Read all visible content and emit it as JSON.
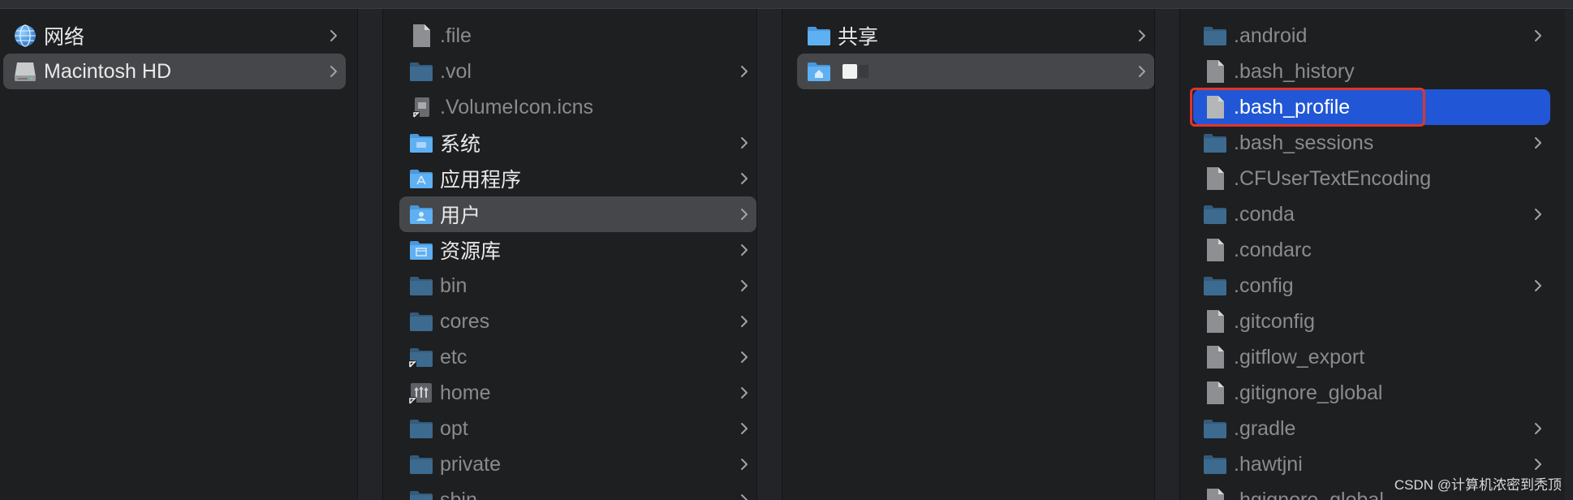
{
  "columns": [
    {
      "items": [
        {
          "label": "网络",
          "icon": "network-globe-icon",
          "chevron": true,
          "state": "normal",
          "tone": "bright"
        },
        {
          "label": "Macintosh HD",
          "icon": "hard-drive-icon",
          "chevron": true,
          "state": "selected-inactive",
          "tone": "bright"
        }
      ]
    },
    {
      "items": [
        {
          "label": ".file",
          "icon": "document-icon",
          "chevron": false,
          "state": "normal",
          "tone": "dim"
        },
        {
          "label": ".vol",
          "icon": "folder-icon",
          "chevron": true,
          "state": "normal",
          "tone": "dim"
        },
        {
          "label": ".VolumeIcon.icns",
          "icon": "alias-icns-file-icon",
          "chevron": false,
          "state": "normal",
          "tone": "dim"
        },
        {
          "label": "系统",
          "icon": "system-folder-icon",
          "chevron": true,
          "state": "normal",
          "tone": "bright"
        },
        {
          "label": "应用程序",
          "icon": "applications-folder-icon",
          "chevron": true,
          "state": "normal",
          "tone": "bright"
        },
        {
          "label": "用户",
          "icon": "users-folder-icon",
          "chevron": true,
          "state": "selected-inactive",
          "tone": "bright"
        },
        {
          "label": "资源库",
          "icon": "library-folder-icon",
          "chevron": true,
          "state": "normal",
          "tone": "bright"
        },
        {
          "label": "bin",
          "icon": "folder-icon",
          "chevron": true,
          "state": "normal",
          "tone": "dim"
        },
        {
          "label": "cores",
          "icon": "folder-icon",
          "chevron": true,
          "state": "normal",
          "tone": "dim"
        },
        {
          "label": "etc",
          "icon": "alias-folder-icon",
          "chevron": true,
          "state": "normal",
          "tone": "dim"
        },
        {
          "label": "home",
          "icon": "network-home-icon",
          "chevron": true,
          "state": "normal",
          "tone": "dim"
        },
        {
          "label": "opt",
          "icon": "folder-icon",
          "chevron": true,
          "state": "normal",
          "tone": "dim"
        },
        {
          "label": "private",
          "icon": "folder-icon",
          "chevron": true,
          "state": "normal",
          "tone": "dim"
        },
        {
          "label": "sbin",
          "icon": "folder-icon",
          "chevron": true,
          "state": "normal",
          "tone": "dim"
        }
      ]
    },
    {
      "items": [
        {
          "label": "共享",
          "icon": "folder-icon",
          "chevron": true,
          "state": "normal",
          "tone": "bright"
        },
        {
          "label": "",
          "icon": "home-folder-icon",
          "chevron": true,
          "state": "selected-inactive",
          "tone": "bright",
          "redacted": true
        }
      ]
    },
    {
      "items": [
        {
          "label": ".android",
          "icon": "folder-icon",
          "chevron": true,
          "state": "normal",
          "tone": "dim"
        },
        {
          "label": ".bash_history",
          "icon": "document-icon",
          "chevron": false,
          "state": "normal",
          "tone": "dim"
        },
        {
          "label": ".bash_profile",
          "icon": "document-icon",
          "chevron": false,
          "state": "selected-active",
          "tone": "white"
        },
        {
          "label": ".bash_sessions",
          "icon": "folder-icon",
          "chevron": true,
          "state": "normal",
          "tone": "dim"
        },
        {
          "label": ".CFUserTextEncoding",
          "icon": "document-icon",
          "chevron": false,
          "state": "normal",
          "tone": "dim"
        },
        {
          "label": ".conda",
          "icon": "folder-icon",
          "chevron": true,
          "state": "normal",
          "tone": "dim"
        },
        {
          "label": ".condarc",
          "icon": "document-icon",
          "chevron": false,
          "state": "normal",
          "tone": "dim"
        },
        {
          "label": ".config",
          "icon": "folder-icon",
          "chevron": true,
          "state": "normal",
          "tone": "dim"
        },
        {
          "label": ".gitconfig",
          "icon": "document-icon",
          "chevron": false,
          "state": "normal",
          "tone": "dim"
        },
        {
          "label": ".gitflow_export",
          "icon": "document-icon",
          "chevron": false,
          "state": "normal",
          "tone": "dim"
        },
        {
          "label": ".gitignore_global",
          "icon": "document-icon",
          "chevron": false,
          "state": "normal",
          "tone": "dim"
        },
        {
          "label": ".gradle",
          "icon": "folder-icon",
          "chevron": true,
          "state": "normal",
          "tone": "dim"
        },
        {
          "label": ".hawtjni",
          "icon": "folder-icon",
          "chevron": true,
          "state": "normal",
          "tone": "dim"
        },
        {
          "label": ".hgignore_global",
          "icon": "document-icon",
          "chevron": false,
          "state": "normal",
          "tone": "dim"
        }
      ]
    }
  ],
  "annotation": {
    "target": ".bash_profile",
    "color": "#e0352b"
  },
  "watermark": "CSDN @计算机浓密到秃顶",
  "colors": {
    "background": "#1e1f21",
    "selection_blue": "#2157d6",
    "selection_gray": "#46474a",
    "folder_blue": "#6db4f0",
    "folder_dim": "#3f6c92"
  }
}
